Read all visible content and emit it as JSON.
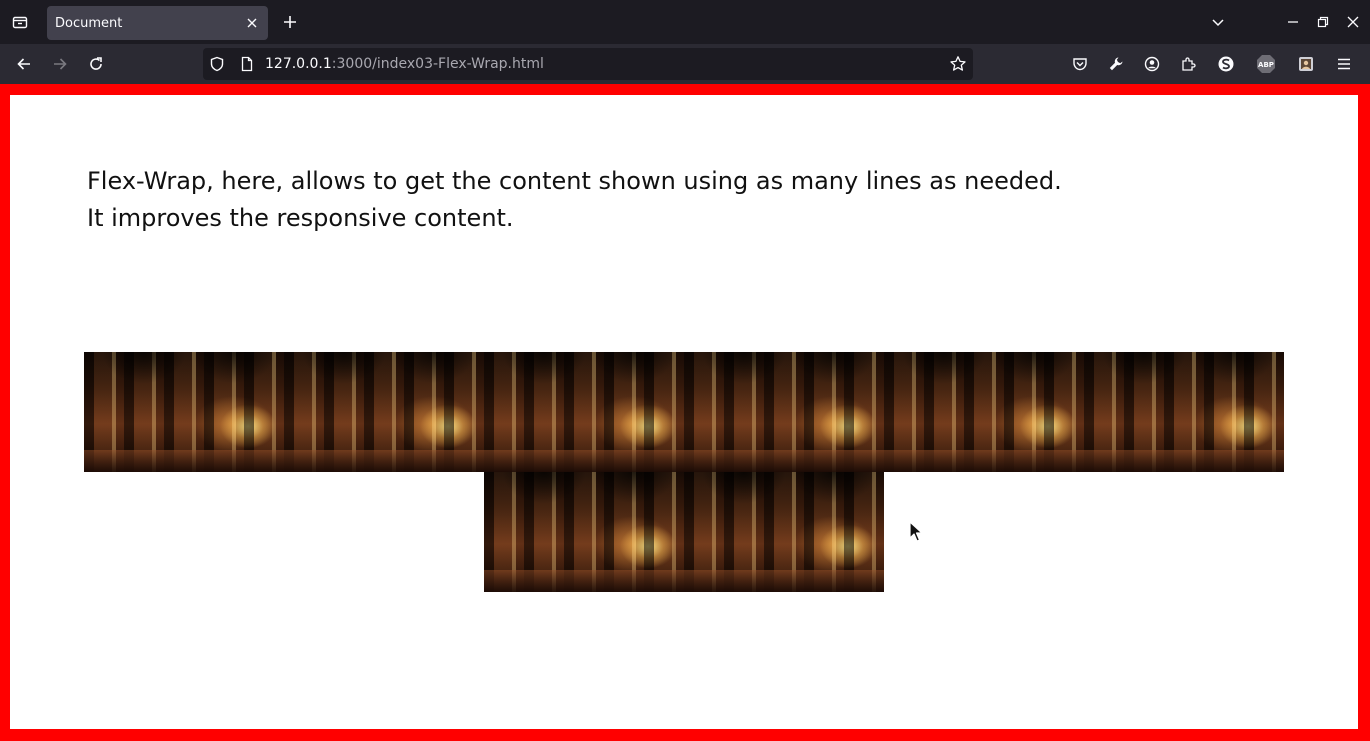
{
  "browser": {
    "tab": {
      "title": "Document"
    },
    "url": {
      "host": "127.0.0.1",
      "rest": ":3000/index03-Flex-Wrap.html"
    },
    "icons": {
      "tab_list": "tab-list-icon",
      "tab_close": "close-icon",
      "new_tab": "plus-icon",
      "list_all_tabs": "chevron-down-icon",
      "minimize": "minimize-icon",
      "restore": "restore-icon",
      "close_window": "close-icon",
      "back": "arrow-left-icon",
      "forward": "arrow-right-icon",
      "reload": "reload-icon",
      "tracking_protection": "shield-icon",
      "page_info": "page-icon",
      "bookmark": "star-icon",
      "pocket": "pocket-icon",
      "devtools": "wrench-icon",
      "account": "account-icon",
      "extensions": "puzzle-icon",
      "addon_s": "addon-s-icon",
      "adblock": "abp-icon",
      "addon_photo": "addon-photo-icon",
      "menu": "hamburger-menu-icon"
    },
    "adblock_label": "ABP"
  },
  "page": {
    "line1": "Flex-Wrap, here, allows to get the content shown using as many lines as needed.",
    "line2": "It improves the responsive content.",
    "image_count": 8,
    "border_color": "#ff0000"
  }
}
